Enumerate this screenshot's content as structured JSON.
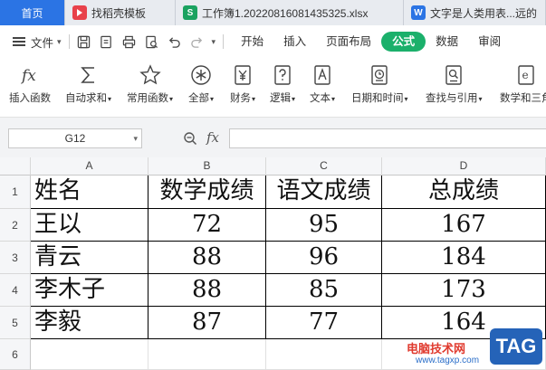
{
  "tabs": [
    {
      "label": "首页",
      "icon": "home-tab",
      "color": "#2b74e4"
    },
    {
      "label": "找稻壳模板",
      "icon": "docer-icon",
      "color": "#e8414a"
    },
    {
      "label": "工作簿1.20220816081435325.xlsx",
      "icon": "et-sheet-icon",
      "color": "#1aa260"
    },
    {
      "label": "文字是人类用表...远的",
      "icon": "wps-writer-icon",
      "color": "#2b74e4"
    }
  ],
  "menubar": {
    "file_label": "文件",
    "tabs": [
      "开始",
      "插入",
      "页面布局",
      "公式",
      "数据",
      "审阅"
    ],
    "active_tab": "公式",
    "active_color": "#1bb06b"
  },
  "ribbon": {
    "buttons": [
      {
        "label": "插入函数",
        "icon": "fx-icon",
        "dropdown": false
      },
      {
        "label": "自动求和",
        "icon": "sigma-icon",
        "dropdown": true
      },
      {
        "label": "常用函数",
        "icon": "star-icon",
        "dropdown": true
      },
      {
        "label": "全部",
        "icon": "asterisk-circle-icon",
        "dropdown": true
      },
      {
        "label": "财务",
        "icon": "yen-icon",
        "dropdown": true
      },
      {
        "label": "逻辑",
        "icon": "question-icon",
        "dropdown": true
      },
      {
        "label": "文本",
        "icon": "text-a-icon",
        "dropdown": true
      },
      {
        "label": "日期和时间",
        "icon": "clock-icon",
        "dropdown": true
      },
      {
        "label": "查找与引用",
        "icon": "magnifier-icon",
        "dropdown": true
      },
      {
        "label": "数学和三角",
        "icon": "math-e-icon",
        "dropdown": false
      }
    ]
  },
  "formula_bar": {
    "name_box": "G12",
    "fx_label": "fx",
    "formula": ""
  },
  "sheet": {
    "columns": [
      "A",
      "B",
      "C",
      "D"
    ],
    "rows": [
      "1",
      "2",
      "3",
      "4",
      "5",
      "6"
    ],
    "cells": [
      [
        "姓名",
        "数学成绩",
        "语文成绩",
        "总成绩"
      ],
      [
        "王以",
        "72",
        "95",
        "167"
      ],
      [
        "青云",
        "88",
        "96",
        "184"
      ],
      [
        "李木子",
        "88",
        "85",
        "173"
      ],
      [
        "李毅",
        "87",
        "77",
        "164"
      ]
    ]
  },
  "watermark": {
    "brand": "电脑技术网",
    "url": "www.tagxp.com",
    "badge": "TAG"
  }
}
